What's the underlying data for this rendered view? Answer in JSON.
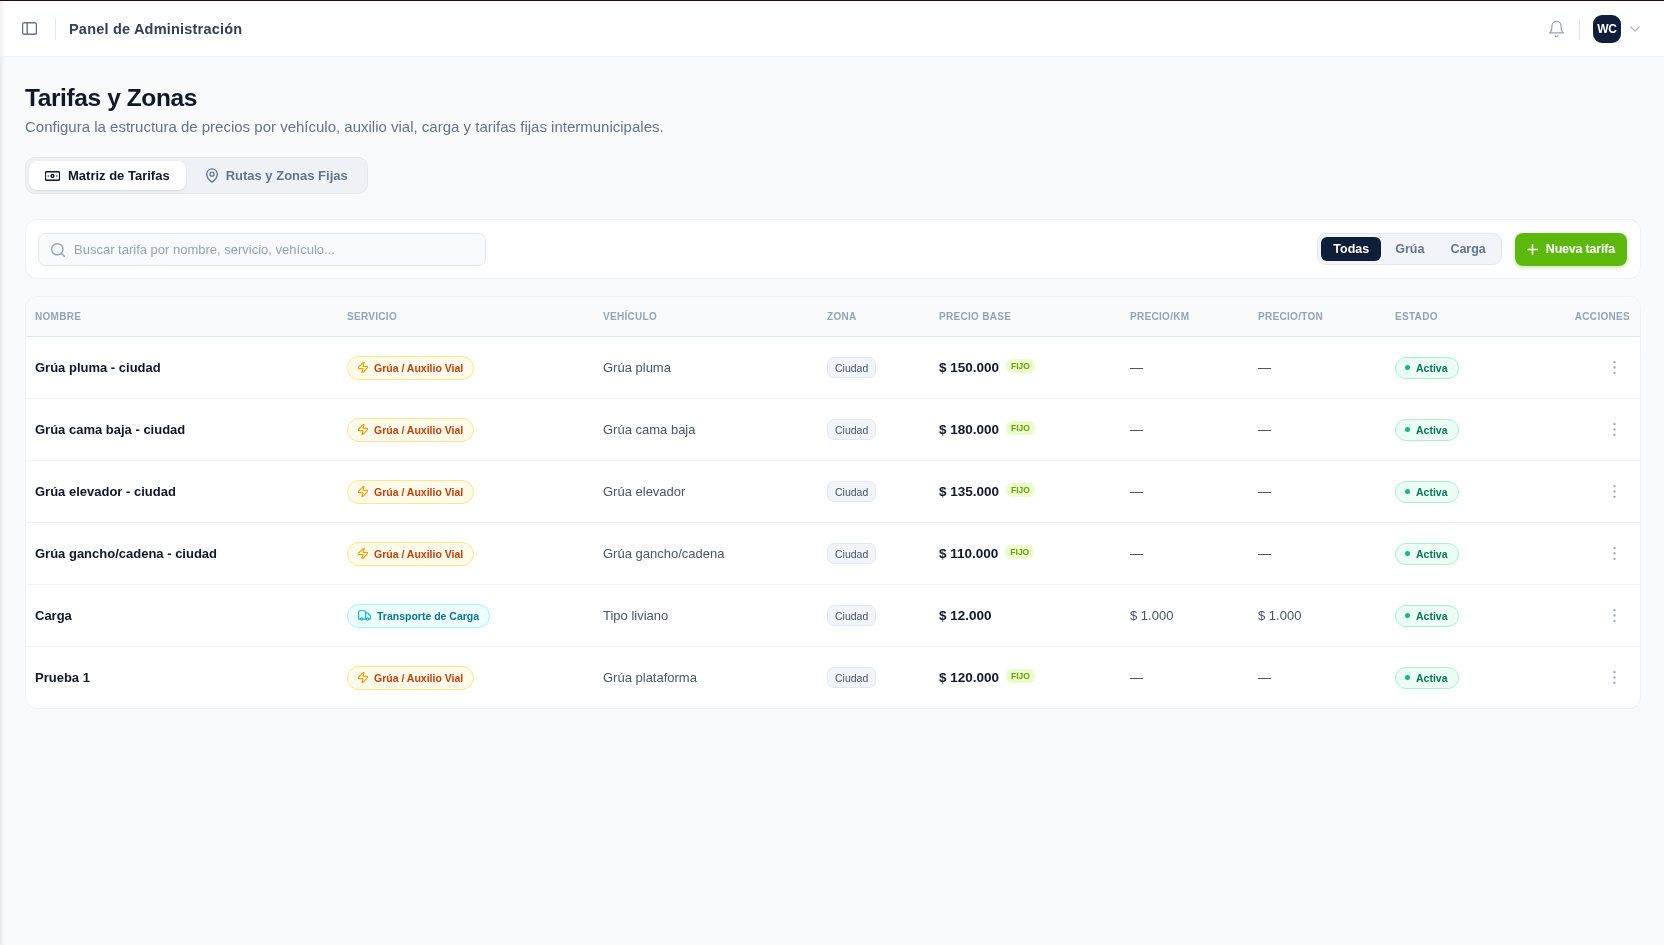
{
  "top_bar": {
    "title": "Panel de Administración",
    "avatar_initials": "WC"
  },
  "page": {
    "title": "Tarifas y Zonas",
    "subtitle": "Configura la estructura de precios por vehículo, auxilio vial, carga y tarifas fijas intermunicipales."
  },
  "tabs": [
    {
      "label": "Matriz de Tarifas",
      "kind": "matrix",
      "selected": true
    },
    {
      "label": "Rutas y Zonas Fijas",
      "kind": "routes",
      "selected": false
    }
  ],
  "toolbar": {
    "search": {
      "placeholder": "Buscar tarifa por nombre, servicio, vehículo..."
    },
    "filters": [
      {
        "label": "Todas",
        "selected": true
      },
      {
        "label": "Grúa",
        "selected": false
      },
      {
        "label": "Carga",
        "selected": false
      }
    ],
    "new_button": "Nueva tarifa"
  },
  "table": {
    "columns": [
      "NOMBRE",
      "SERVICIO",
      "VEHÍCULO",
      "ZONA",
      "PRECIO BASE",
      "PRECIO/KM",
      "PRECIO/TON",
      "ESTADO",
      "ACCIONES"
    ],
    "rows": [
      {
        "name": "Grúa pluma - ciudad",
        "service": {
          "label": "Grúa / Auxilio Vial",
          "kind": "tow"
        },
        "vehicle": "Grúa pluma",
        "zone": "Ciudad",
        "base_price": "$ 150.000",
        "tag": "FIJO",
        "price_km": "—",
        "price_ton": "—",
        "status": "Activa"
      },
      {
        "name": "Grúa cama baja - ciudad",
        "service": {
          "label": "Grúa / Auxilio Vial",
          "kind": "tow"
        },
        "vehicle": "Grúa cama baja",
        "zone": "Ciudad",
        "base_price": "$ 180.000",
        "tag": "FIJO",
        "price_km": "—",
        "price_ton": "—",
        "status": "Activa"
      },
      {
        "name": "Grúa elevador - ciudad",
        "service": {
          "label": "Grúa / Auxilio Vial",
          "kind": "tow"
        },
        "vehicle": "Grúa elevador",
        "zone": "Ciudad",
        "base_price": "$ 135.000",
        "tag": "FIJO",
        "price_km": "—",
        "price_ton": "—",
        "status": "Activa"
      },
      {
        "name": "Grúa gancho/cadena - ciudad",
        "service": {
          "label": "Grúa / Auxilio Vial",
          "kind": "tow"
        },
        "vehicle": "Grúa gancho/cadena",
        "zone": "Ciudad",
        "base_price": "$ 110.000",
        "tag": "FIJO",
        "price_km": "—",
        "price_ton": "—",
        "status": "Activa"
      },
      {
        "name": "Carga",
        "service": {
          "label": "Transporte de Carga",
          "kind": "cargo"
        },
        "vehicle": "Tipo liviano",
        "zone": "Ciudad",
        "base_price": "$ 12.000",
        "price_km": "$ 1.000",
        "price_ton": "$ 1.000",
        "status": "Activa"
      },
      {
        "name": "Prueba 1",
        "service": {
          "label": "Grúa / Auxilio Vial",
          "kind": "tow"
        },
        "vehicle": "Grúa plataforma",
        "zone": "Ciudad",
        "base_price": "$ 120.000",
        "tag": "FIJO",
        "price_km": "—",
        "price_ton": "—",
        "status": "Activa"
      }
    ]
  }
}
